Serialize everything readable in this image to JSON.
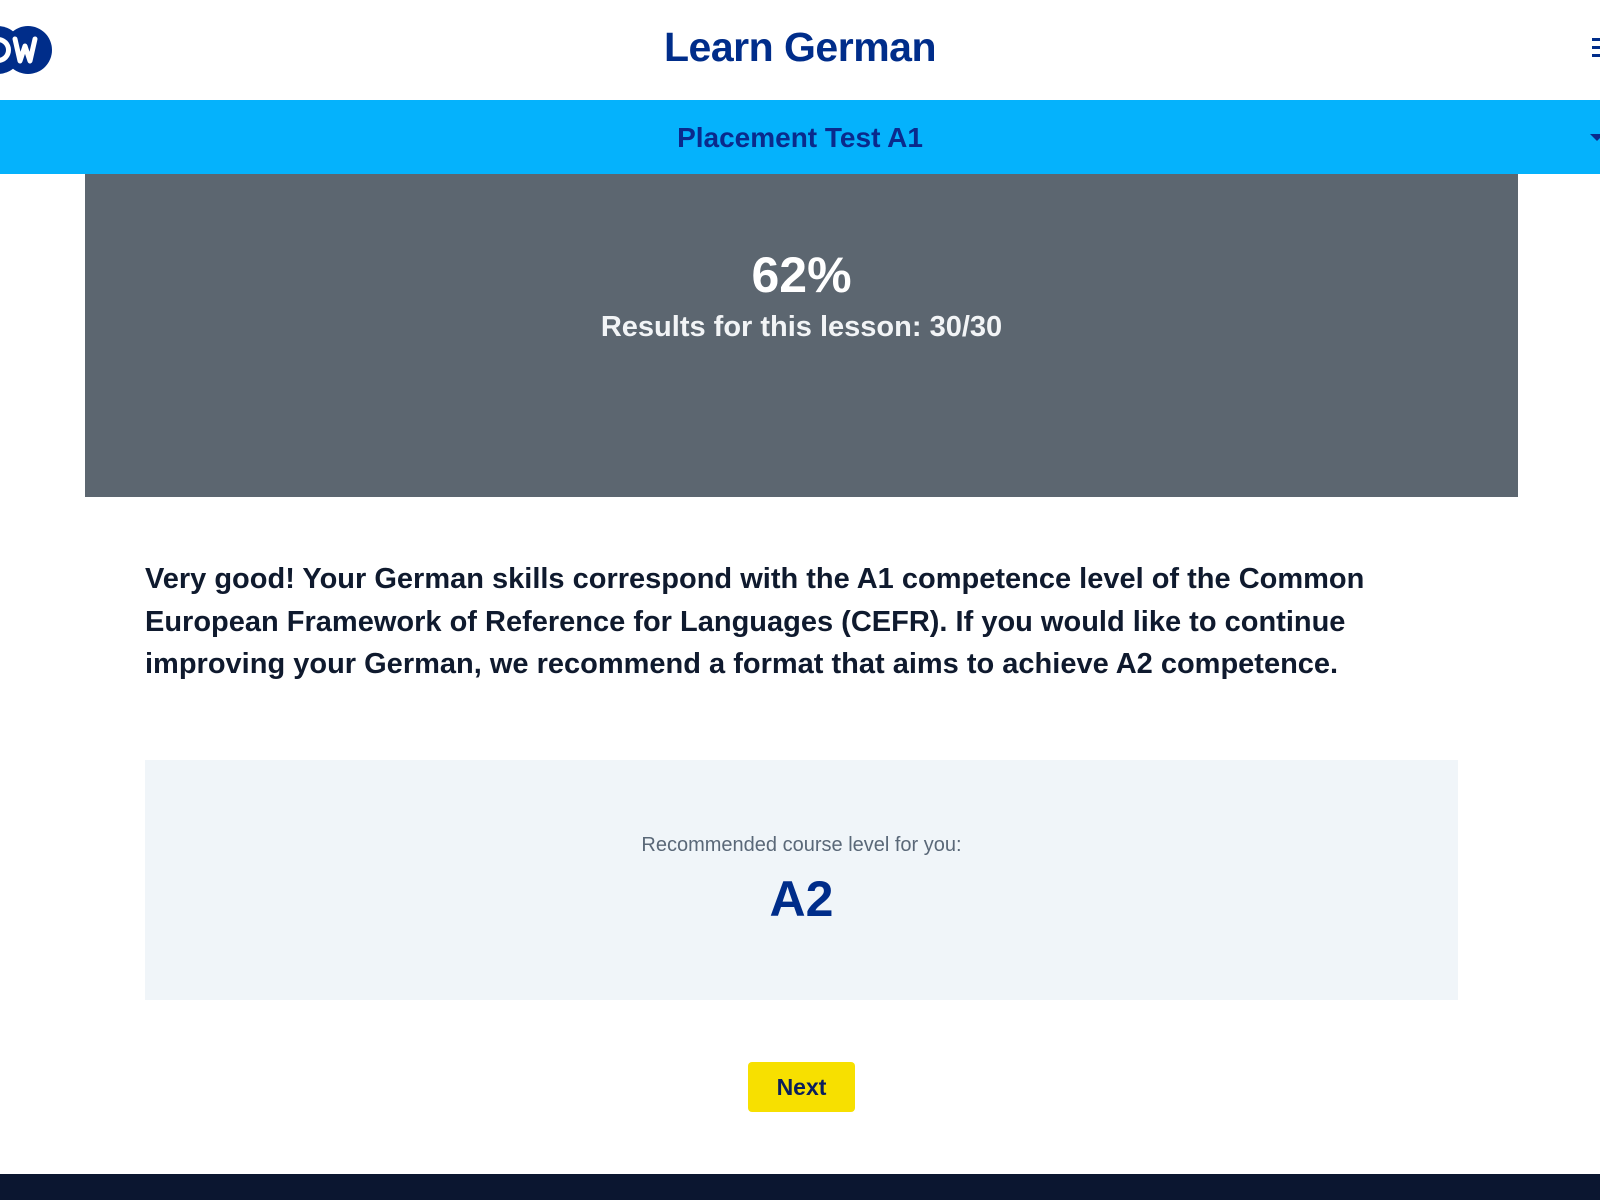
{
  "header": {
    "logo_text": "DW",
    "title": "Learn German",
    "menu_icon": "hamburger-menu-icon"
  },
  "sub_header": {
    "title": "Placement Test A1",
    "toggle_icon": "chevron-down-icon"
  },
  "results": {
    "score": "62%",
    "summary": "Results for this lesson: 30/30"
  },
  "feedback": {
    "text": "Very good! Your German skills correspond with the A1 competence level of the Common European Framework of Reference for Languages (CEFR). If you would like to continue improving your German, we recommend a format that aims to achieve A2 competence."
  },
  "recommendation": {
    "label": "Recommended course level for you:",
    "level": "A2"
  },
  "actions": {
    "next_label": "Next"
  },
  "colors": {
    "brand_navy": "#002d8a",
    "sub_header_blue": "#05b2fc",
    "results_gray": "#5c6670",
    "button_yellow": "#f7e000",
    "footer_dark": "#0b1630"
  }
}
